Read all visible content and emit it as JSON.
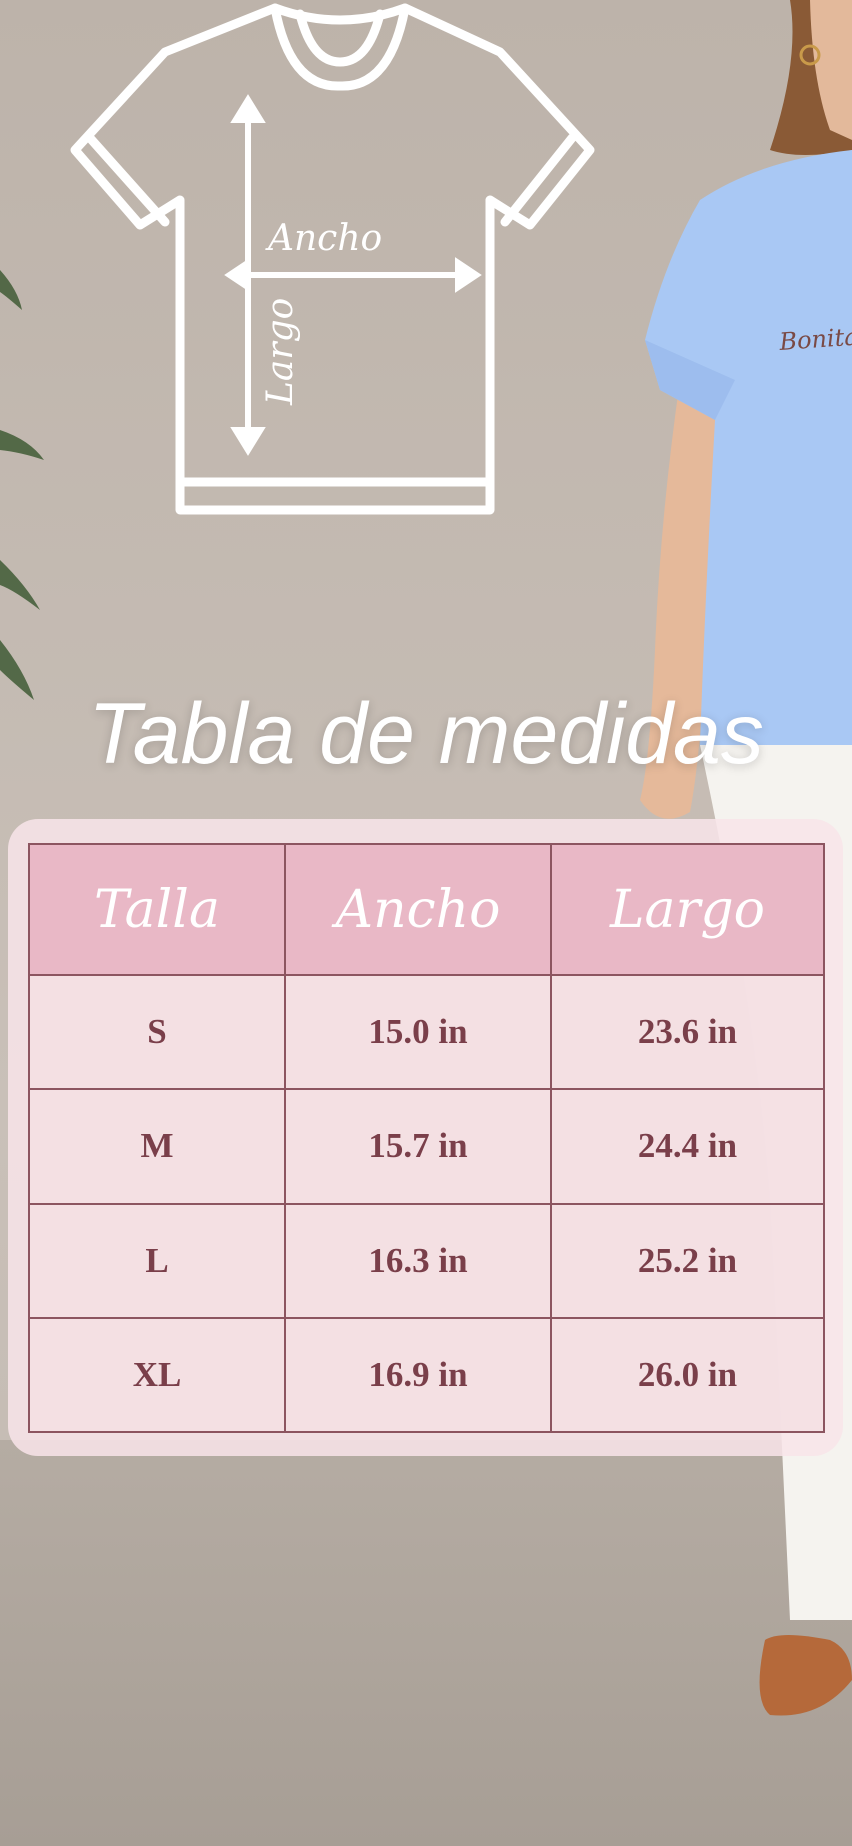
{
  "diagram": {
    "width_label": "Ancho",
    "length_label": "Largo"
  },
  "title": "Tabla de medidas",
  "shirt_print_text": "Bonita, ",
  "table": {
    "headers": [
      "Talla",
      "Ancho",
      "Largo"
    ],
    "rows": [
      [
        "S",
        "15.0 in",
        "23.6 in"
      ],
      [
        "M",
        "15.7 in",
        "24.4 in"
      ],
      [
        "L",
        "16.3 in",
        "25.2 in"
      ],
      [
        "XL",
        "16.9 in",
        "26.0 in"
      ]
    ]
  },
  "colors": {
    "header_bg": "#e9b8c6",
    "cell_text": "#7a3f4a",
    "grid_lines": "#8c5560",
    "shirt_worn": "#a9c8f4"
  }
}
